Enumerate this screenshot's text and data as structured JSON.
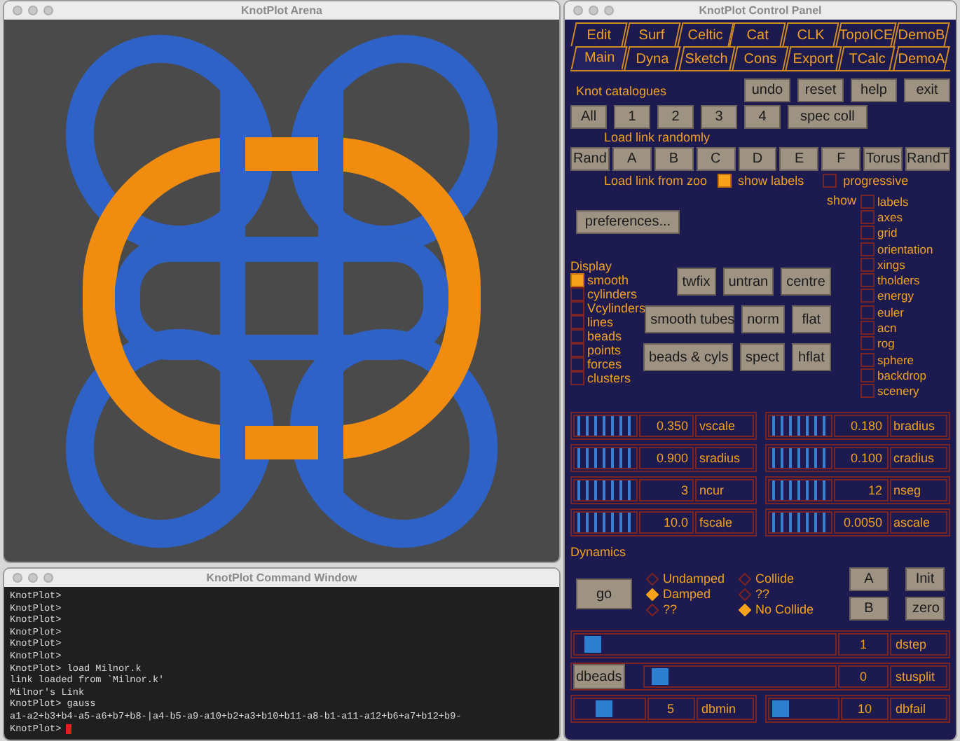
{
  "arena": {
    "title": "KnotPlot Arena"
  },
  "command_window": {
    "title": "KnotPlot Command Window",
    "lines": [
      "KnotPlot>",
      "KnotPlot>",
      "KnotPlot>",
      "KnotPlot>",
      "KnotPlot>",
      "KnotPlot>",
      "KnotPlot> load Milnor.k",
      "link loaded from `Milnor.k'",
      "Milnor's Link",
      "KnotPlot> gauss",
      "a1-a2+b3+b4-a5-a6+b7+b8-|a4-b5-a9-a10+b2+a3+b10+b11-a8-b1-a11-a12+b6+a7+b12+b9-"
    ],
    "prompt": "KnotPlot>"
  },
  "control_panel": {
    "title": "KnotPlot Control Panel",
    "tab_rows": [
      [
        {
          "label": "Edit",
          "selected": false
        },
        {
          "label": "Surf",
          "selected": false
        },
        {
          "label": "Celtic",
          "selected": false
        },
        {
          "label": "Cat",
          "selected": false
        },
        {
          "label": "CLK",
          "selected": false
        },
        {
          "label": "TopoICE",
          "selected": false
        },
        {
          "label": "DemoB",
          "selected": false
        }
      ],
      [
        {
          "label": "Main",
          "selected": true
        },
        {
          "label": "Dyna",
          "selected": false
        },
        {
          "label": "Sketch",
          "selected": false
        },
        {
          "label": "Cons",
          "selected": false
        },
        {
          "label": "Export",
          "selected": false
        },
        {
          "label": "TCalc",
          "selected": false
        },
        {
          "label": "DemoA",
          "selected": false
        }
      ]
    ],
    "catalogues": {
      "label": "Knot catalogues",
      "actions": [
        "undo",
        "reset",
        "help",
        "exit"
      ],
      "buttons": [
        "All",
        "1",
        "2",
        "3",
        "4",
        "spec coll"
      ]
    },
    "random": {
      "label": "Load link randomly",
      "buttons": [
        "Rand",
        "A",
        "B",
        "C",
        "D",
        "E",
        "F",
        "Torus",
        "RandT"
      ]
    },
    "zoo": {
      "label": "Load link from zoo",
      "options": [
        {
          "label": "show labels",
          "checked": true
        },
        {
          "label": "progressive",
          "checked": false
        }
      ]
    },
    "preferences": "preferences...",
    "display": {
      "label": "Display",
      "items": [
        {
          "label": "smooth",
          "checked": true
        },
        {
          "label": "cylinders",
          "checked": false
        },
        {
          "label": "Vcylinders",
          "checked": false
        },
        {
          "label": "lines",
          "checked": false
        },
        {
          "label": "beads",
          "checked": false
        },
        {
          "label": "points",
          "checked": false
        },
        {
          "label": "forces",
          "checked": false
        },
        {
          "label": "clusters",
          "checked": false
        }
      ],
      "buttons": [
        [
          "twfix",
          "untran",
          "centre"
        ],
        [
          "smooth tubes",
          "norm",
          "flat"
        ],
        [
          "beads & cyls",
          "spect",
          "hflat"
        ]
      ]
    },
    "show": {
      "label": "show",
      "items": [
        {
          "label": "labels",
          "checked": false
        },
        {
          "label": "axes",
          "checked": false
        },
        {
          "label": "grid",
          "checked": false
        },
        {
          "label": "orientation",
          "checked": false
        },
        {
          "label": "xings",
          "checked": false
        },
        {
          "label": "tholders",
          "checked": false
        },
        {
          "label": "energy",
          "checked": false
        },
        {
          "label": "euler",
          "checked": false
        },
        {
          "label": "acn",
          "checked": false
        },
        {
          "label": "rog",
          "checked": false
        },
        {
          "label": "sphere",
          "checked": false
        },
        {
          "label": "backdrop",
          "checked": false
        },
        {
          "label": "scenery",
          "checked": false
        }
      ]
    },
    "parameters": [
      {
        "value": "0.350",
        "label": "vscale"
      },
      {
        "value": "0.180",
        "label": "bradius"
      },
      {
        "value": "0.900",
        "label": "sradius"
      },
      {
        "value": "0.100",
        "label": "cradius"
      },
      {
        "value": "3",
        "label": "ncur"
      },
      {
        "value": "12",
        "label": "nseg"
      },
      {
        "value": "10.0",
        "label": "fscale"
      },
      {
        "value": "0.0050",
        "label": "ascale"
      }
    ],
    "dynamics": {
      "label": "Dynamics",
      "go": "go",
      "damping": [
        {
          "label": "Undamped",
          "selected": false
        },
        {
          "label": "Damped",
          "selected": true
        },
        {
          "label": "??",
          "selected": false
        }
      ],
      "collision": [
        {
          "label": "Collide",
          "selected": false
        },
        {
          "label": "??",
          "selected": false
        },
        {
          "label": "No Collide",
          "selected": true
        }
      ],
      "buttons": [
        "A",
        "Init",
        "B",
        "zero"
      ],
      "sliders": [
        {
          "kind": "wide",
          "value": "1",
          "label": "dstep",
          "level": 0.04
        },
        {
          "kind": "button",
          "button": "dbeads",
          "value": "0",
          "label": "stusplit",
          "level": 0.04
        },
        {
          "kind": "half",
          "value": "5",
          "label": "dbmin",
          "level": 0.4
        },
        {
          "kind": "half",
          "value": "10",
          "label": "dbfail",
          "level": 0.08
        }
      ]
    }
  }
}
